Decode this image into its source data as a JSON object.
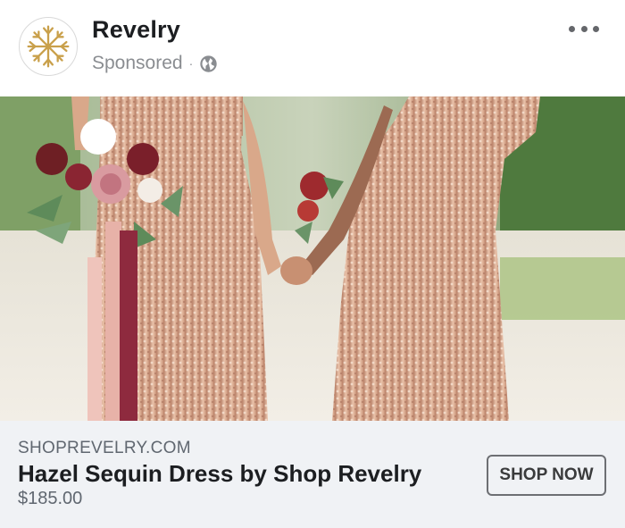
{
  "post": {
    "page_name": "Revelry",
    "sponsored_label": "Sponsored",
    "separator": "·",
    "privacy_icon": "globe-icon",
    "more_icon": "more-options-icon",
    "avatar_icon": "revelry-logo"
  },
  "image": {
    "subject": "bridesmaids-sequin-dresses"
  },
  "link_card": {
    "domain": "SHOPREVELRY.COM",
    "headline": "Hazel Sequin Dress by Shop Revelry",
    "price": "$185.00",
    "cta_label": "SHOP NOW"
  },
  "colors": {
    "text_primary": "#1c1e21",
    "text_secondary": "#606770",
    "footer_background": "#f0f2f5",
    "logo_gold": "#c9a04b"
  }
}
